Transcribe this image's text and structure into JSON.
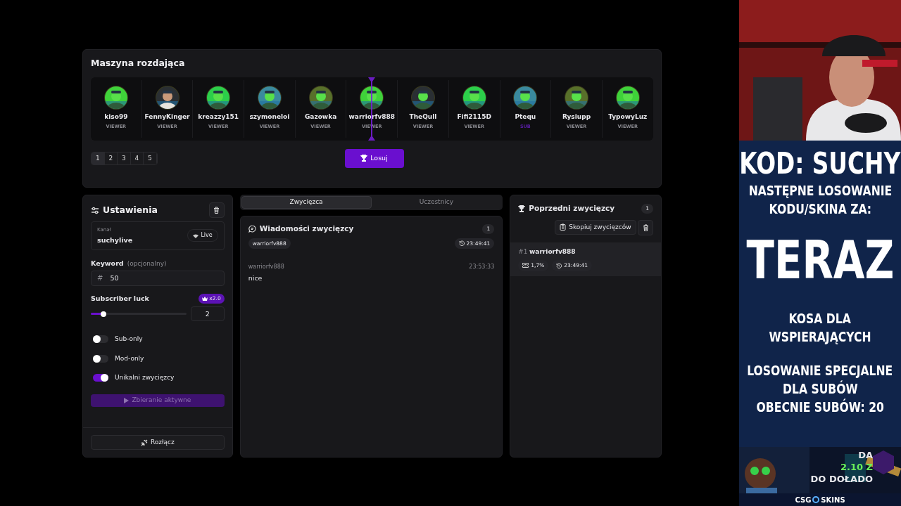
{
  "dealer": {
    "title": "Maszyna rozdająca",
    "participants": [
      {
        "name": "kiso99",
        "role": "VIEWER",
        "kind": "viewer",
        "selected": false
      },
      {
        "name": "FennyKinger",
        "role": "VIEWER",
        "kind": "viewer",
        "selected": false
      },
      {
        "name": "kreazzy151",
        "role": "VIEWER",
        "kind": "viewer",
        "selected": false
      },
      {
        "name": "szymoneloi",
        "role": "VIEWER",
        "kind": "viewer",
        "selected": false
      },
      {
        "name": "Gazowka",
        "role": "VIEWER",
        "kind": "viewer",
        "selected": false
      },
      {
        "name": "warriorfv888",
        "role": "VIEWER",
        "kind": "viewer",
        "selected": true
      },
      {
        "name": "TheQull",
        "role": "VIEWER",
        "kind": "viewer",
        "selected": false
      },
      {
        "name": "Fifi2115D",
        "role": "VIEWER",
        "kind": "viewer",
        "selected": false
      },
      {
        "name": "Ptequ",
        "role": "SUB",
        "kind": "sub",
        "selected": false
      },
      {
        "name": "Rysiupp",
        "role": "VIEWER",
        "kind": "viewer",
        "selected": false
      },
      {
        "name": "TypowyLuz",
        "role": "VIEWER",
        "kind": "viewer",
        "selected": false
      }
    ],
    "pages": [
      {
        "label": "1",
        "selected": true
      },
      {
        "label": "2",
        "selected": false
      },
      {
        "label": "3",
        "selected": false
      },
      {
        "label": "4",
        "selected": false
      },
      {
        "label": "5",
        "selected": false
      }
    ],
    "draw_button": "Losuj"
  },
  "settings": {
    "title": "Ustawienia",
    "channel": {
      "label": "Kanał",
      "value": "suchylive",
      "status": "Live"
    },
    "keyword": {
      "label": "Keyword",
      "hint": "(opcjonalny)",
      "prefix": "#",
      "value": "50"
    },
    "subscriber_luck": {
      "label": "Subscriber luck",
      "multiplier": "x2.0",
      "level": 0.13,
      "value": "2"
    },
    "toggles": [
      {
        "label": "Sub-only",
        "on": false
      },
      {
        "label": "Mod-only",
        "on": false
      },
      {
        "label": "Unikalni zwycięzcy",
        "on": true
      }
    ],
    "collect_button": "Zbieranie aktywne",
    "disconnect_button": "Rozłącz"
  },
  "center": {
    "tabs": [
      {
        "label": "Zwycięzca",
        "selected": true
      },
      {
        "label": "Uczestnicy",
        "selected": false
      }
    ],
    "messages": {
      "title": "Wiadomości zwycięzcy",
      "count": "1",
      "winner": "warriorfv888",
      "time": "23:49:41",
      "items": [
        {
          "user": "warriorfv888",
          "time": "23:53:33",
          "text": "nice"
        }
      ]
    }
  },
  "previous": {
    "title": "Poprzedni zwycięzcy",
    "count": "1",
    "copy_button": "Skopiuj zwycięzców",
    "winners": [
      {
        "rank": "#1",
        "name": "warriorfv888",
        "chance": "1,7%",
        "time": "23:49:41"
      }
    ]
  },
  "overlay": {
    "lines": [
      {
        "kind": "large",
        "text": "KOD: SUCHY"
      },
      {
        "kind": "medium",
        "text": "NASTĘPNE LOSOWANIE"
      },
      {
        "kind": "medium",
        "text": "KODU/SKINA ZA:"
      },
      {
        "kind": "huge",
        "text": "TERAZ"
      },
      {
        "kind": "medium",
        "text": "KOSA DLA"
      },
      {
        "kind": "medium",
        "text": "WSPIERAJĄCYCH"
      },
      {
        "kind": "gap"
      },
      {
        "kind": "medium",
        "text": "LOSOWANIE SPECJALNE"
      },
      {
        "kind": "medium",
        "text": "DLA SUBÓW"
      },
      {
        "kind": "medium",
        "text": "OBECNIE SUBÓW: 20"
      }
    ]
  },
  "ad": {
    "lines": [
      "DA",
      "2.10 Z",
      "DO DOŁADO"
    ],
    "brand_left": "CSG",
    "brand_right": "SKINS"
  }
}
